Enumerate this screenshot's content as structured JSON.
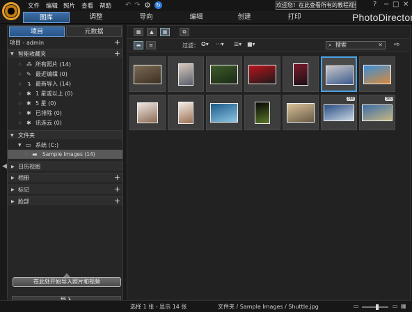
{
  "menu": {
    "items": [
      "文件",
      "编辑",
      "照片",
      "查看",
      "帮助"
    ],
    "welcome": "欢迎您！在此查看所有的教程视频！",
    "window_buttons": [
      "?",
      "−",
      "□",
      "✕"
    ]
  },
  "modes": {
    "tabs": [
      "图库",
      "调整",
      "导向",
      "编辑",
      "创建",
      "打印"
    ],
    "active_index": 0,
    "brand": "PhotoDirector"
  },
  "left_panel": {
    "tabs": [
      "项目",
      "元数据"
    ],
    "active_tab": 0,
    "project_header": "项目 - admin",
    "smart_header": "智能收藏夹",
    "smart_items": [
      {
        "label": "所有照片 (14)",
        "icon": "all-photos-icon"
      },
      {
        "label": "最近编辑 (0)",
        "icon": "recent-edit-icon"
      },
      {
        "label": "最新导入 (14)",
        "icon": "recent-import-icon"
      },
      {
        "label": "1 星或以上 (0)",
        "icon": "star-icon"
      },
      {
        "label": "5 星 (0)",
        "icon": "star-icon"
      },
      {
        "label": "已排除 (0)",
        "icon": "excluded-icon"
      },
      {
        "label": "讯连云 (0)",
        "icon": "cloud-icon"
      }
    ],
    "folder_header": "文件夹",
    "drive": "系统 (C:)",
    "folder_selected": "Sample Images (14)",
    "sections": [
      "日历视图",
      "相册",
      "标记",
      "脸部"
    ],
    "cta": "在此处开始导入照片和视频",
    "import_label": "导入"
  },
  "toolbar": {
    "filter_label": "过滤：",
    "search_placeholder": "搜索"
  },
  "thumbnails": [
    {
      "name": "thumb-1",
      "colors": [
        "#7a6a55",
        "#3d2f22"
      ],
      "frame": "landscape"
    },
    {
      "name": "thumb-2",
      "colors": [
        "#d8c9bd",
        "#5a5f6d"
      ],
      "frame": "portrait"
    },
    {
      "name": "thumb-3",
      "colors": [
        "#3d5a2c",
        "#1b2a15"
      ],
      "frame": "landscape"
    },
    {
      "name": "thumb-4",
      "colors": [
        "#b9141c",
        "#1a1a1a"
      ],
      "frame": "landscape"
    },
    {
      "name": "thumb-5",
      "colors": [
        "#7a1b2d",
        "#1c0f16"
      ],
      "frame": "portrait"
    },
    {
      "name": "thumb-6",
      "colors": [
        "#c9c7c9",
        "#3b5b8e"
      ],
      "frame": "landscape",
      "selected": true
    },
    {
      "name": "thumb-7",
      "colors": [
        "#3d8ed8",
        "#d78a3a"
      ],
      "frame": "landscape"
    },
    {
      "name": "thumb-8",
      "colors": [
        "#efe7e2",
        "#8b6b55"
      ],
      "frame": "square"
    },
    {
      "name": "thumb-9",
      "colors": [
        "#f2ede8",
        "#9c7153"
      ],
      "frame": "portrait"
    },
    {
      "name": "thumb-10",
      "colors": [
        "#1b5b8a",
        "#8ec5e3"
      ],
      "frame": "landscape"
    },
    {
      "name": "thumb-11",
      "colors": [
        "#050505",
        "#5b7a2a"
      ],
      "frame": "portrait"
    },
    {
      "name": "thumb-12",
      "colors": [
        "#d7c29a",
        "#6b5a45"
      ],
      "frame": "landscape"
    },
    {
      "name": "thumb-13",
      "colors": [
        "#2b4e86",
        "#c9d6e2"
      ],
      "frame": "pano",
      "badge": "360"
    },
    {
      "name": "thumb-14",
      "colors": [
        "#3b6ea8",
        "#c7b682"
      ],
      "frame": "pano",
      "badge": "360"
    }
  ],
  "status": {
    "selection": "选择 1 张 - 显示 14 张",
    "path": "文件夹 / Sample Images / Shuttle.jpg",
    "zoom_level": 0.6
  }
}
